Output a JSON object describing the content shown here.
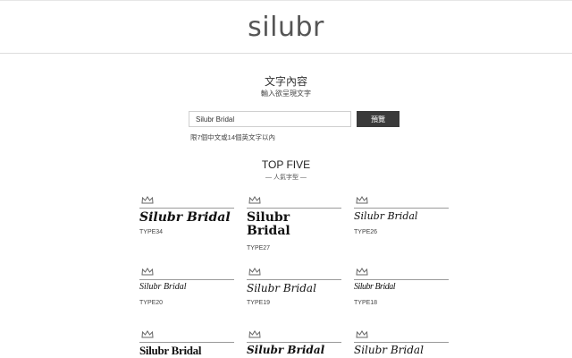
{
  "header": {
    "logo": "silubr"
  },
  "text_section": {
    "title": "文字內容",
    "subtitle": "輸入欲呈現文字",
    "input_value": "Silubr Bridal",
    "preview_label": "預覽",
    "limit_note": "限7個中文或14個英文字以內"
  },
  "top_five": {
    "title": "TOP FIVE",
    "subtitle": "— 人氣字型 —"
  },
  "cards": [
    {
      "sample": "Silubr Bridal",
      "type": "TYPE34",
      "icon": "crown-icon"
    },
    {
      "sample": "Silubr Bridal",
      "type": "TYPE27",
      "icon": "crown-icon"
    },
    {
      "sample": "Silubr Bridal",
      "type": "TYPE26",
      "icon": "crown-icon"
    },
    {
      "sample": "Silubr Bridal",
      "type": "TYPE20",
      "icon": "crown-icon"
    },
    {
      "sample": "Silubr Bridal",
      "type": "TYPE19",
      "icon": "crown-icon"
    },
    {
      "sample": "Silubr Bridal",
      "type": "TYPE18",
      "icon": "crown-icon"
    },
    {
      "sample": "Silubr Bridal",
      "icon": "crown-icon"
    },
    {
      "sample": "Silubr Bridal",
      "icon": "crown-icon"
    },
    {
      "sample": "Silubr Bridal",
      "icon": "crown-icon"
    }
  ]
}
